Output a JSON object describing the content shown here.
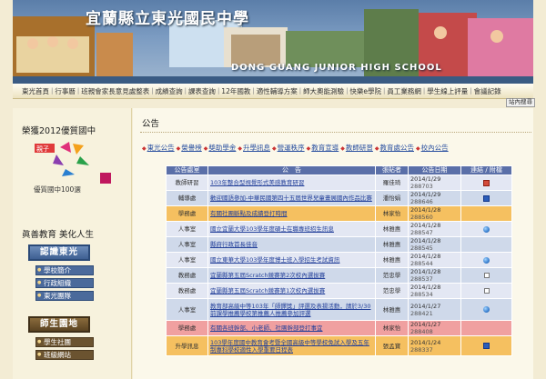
{
  "banner": {
    "title": "宜蘭縣立東光國民中學",
    "subtitle": "DONG GUANG JUNIOR HIGH SCHOOL"
  },
  "nav": {
    "items": [
      "東光首頁",
      "行事曆",
      "班親會家長意見處整表",
      "成績查詢",
      "課表查詢",
      "12年國教",
      "適性輔導方案",
      "師大奧能測驗",
      "快樂e學院",
      "員工業務網",
      "學生線上評量",
      "會議記錄"
    ],
    "search_label": "站內搜尋"
  },
  "sidebar": {
    "heading1": "榮獲2012優質國中",
    "quality_label": "優質國中100選",
    "heading2": "眞善教育 美化人生",
    "board1": "認識東光",
    "links1": [
      "學校簡介",
      "行政組織",
      "東光團隊"
    ],
    "board2": "師生園地",
    "links2": [
      "學生社團",
      "班級網站"
    ]
  },
  "main": {
    "title": "公告",
    "categories": [
      "東光公告",
      "榮譽榜",
      "獎助學金",
      "升學訊息",
      "營運秩序",
      "教育宣導",
      "教師研習",
      "教育處公告",
      "校內公告"
    ],
    "columns": [
      "公告處室",
      "公　告",
      "張貼者",
      "公告日期",
      "連結 / 附檔"
    ],
    "rows": [
      {
        "unit": "教師研習",
        "title": "103年整合型視覺形式美感教育研習",
        "poster": "羅佳琦",
        "date": "2014/1/29",
        "no": "288703",
        "link": "pdf",
        "bg": "#e3e7f3"
      },
      {
        "unit": "輔導處",
        "title": "歡迎國語參加-中華民國第四十五屆世界兒童畫展國內作品比賽",
        "poster": "潘怡娟",
        "date": "2014/1/29",
        "no": "288646",
        "link": "word",
        "bg": "#cfd9ea"
      },
      {
        "unit": "學務處",
        "title": "有關社團斷點及成績登打時間",
        "poster": "林家怡",
        "date": "2014/1/28",
        "no": "288560",
        "link": "",
        "bg": "#f5c060"
      },
      {
        "unit": "人事室",
        "title": "國立宜蘭大學103學年度碩士在職專班招生訊息",
        "poster": "林雅惠",
        "date": "2014/1/28",
        "no": "288547",
        "link": "globe",
        "bg": "#e3e7f3"
      },
      {
        "unit": "人事室",
        "title": "縣府行政首長佳音",
        "poster": "林雅惠",
        "date": "2014/1/28",
        "no": "288545",
        "link": "",
        "bg": "#cfd9ea"
      },
      {
        "unit": "人事室",
        "title": "國立東華大學103學年度博士班入學招生考試資訊",
        "poster": "林雅惠",
        "date": "2014/1/28",
        "no": "288544",
        "link": "globe",
        "bg": "#e3e7f3"
      },
      {
        "unit": "教務處",
        "title": "宜蘭縣第五屆Scratch競賽第2次校內選拔賽",
        "poster": "范忠學",
        "date": "2014/1/28",
        "no": "288537",
        "link": "check",
        "bg": "#cfd9ea"
      },
      {
        "unit": "教務處",
        "title": "宜蘭縣第五屆Scratch競賽第1次校內選拔賽",
        "poster": "范忠學",
        "date": "2014/1/28",
        "no": "288534",
        "link": "check",
        "bg": "#e3e7f3"
      },
      {
        "unit": "人事室",
        "title": "教育部高級中等103年「師鐸獎」評選及表揚活動，請於3/30前課學推薦學校第推薦人推薦參加評選",
        "poster": "林雅惠",
        "date": "2014/1/27",
        "no": "288421",
        "link": "globe",
        "bg": "#cfd9ea"
      },
      {
        "unit": "學務處",
        "title": "有關各班幹部、小老師、社團幹部登打事宜",
        "poster": "林家怡",
        "date": "2014/1/27",
        "no": "288408",
        "link": "",
        "bg": "#f0a0a0"
      },
      {
        "unit": "升學訊息",
        "title": "103學年度國中教育會考暨全國高級中等學校免試入學及五年制專科學校適性入學重要日程表",
        "poster": "張孟寶",
        "date": "2014/1/24",
        "no": "288337",
        "link": "word",
        "bg": "#f5c060"
      }
    ]
  },
  "colors": {
    "nav_bg": "#ece2bf",
    "table_header": "#5a6fa8",
    "link": "#23409a",
    "page_bg": "#f3ecd4"
  }
}
